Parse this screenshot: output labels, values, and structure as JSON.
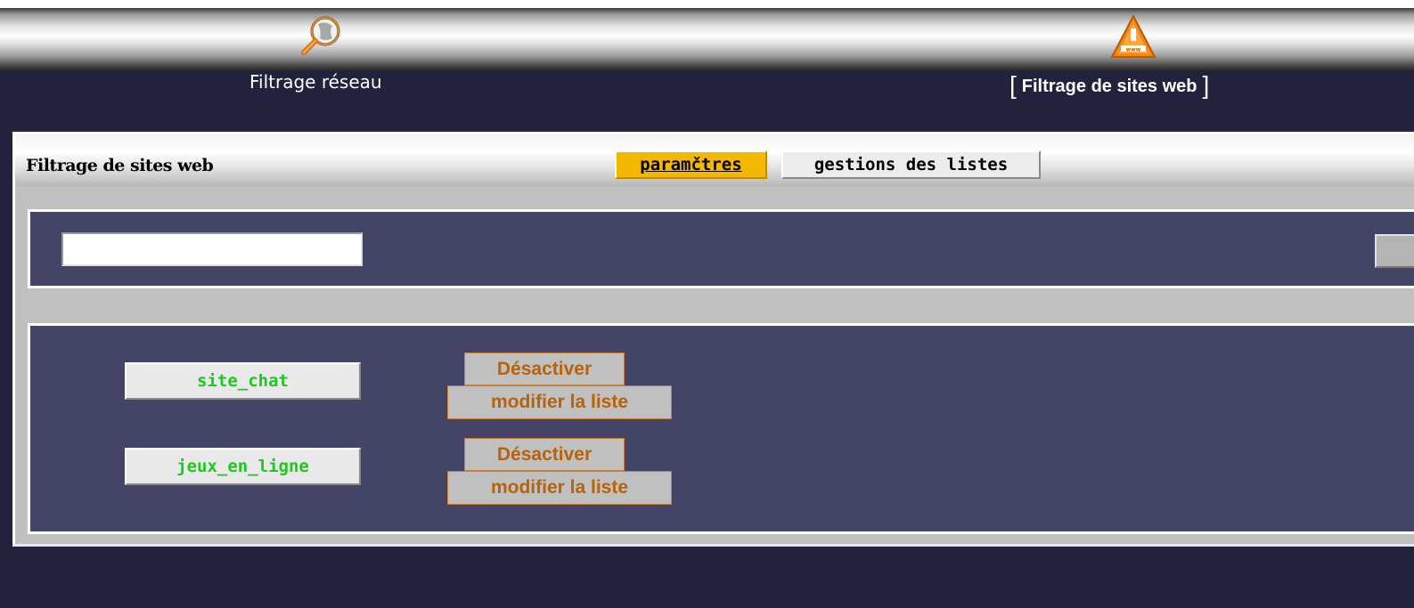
{
  "nav": {
    "items": [
      {
        "label": "Filtrage réseau",
        "icon": "network-filter-icon",
        "active": false
      },
      {
        "label": "Filtrage de sites web",
        "icon": "web-filter-warning-icon",
        "active": true
      }
    ],
    "active_bracket_open": "[",
    "active_bracket_close": "]"
  },
  "panel": {
    "title": "Filtrage de sites web",
    "tabs": [
      {
        "label": "paramčtres",
        "active": true
      },
      {
        "label": "gestions des listes",
        "active": false
      }
    ]
  },
  "search": {
    "value": "",
    "placeholder": ""
  },
  "lists": [
    {
      "name": "site_chat",
      "deactivate_label": "Désactiver",
      "modify_label": "modifier la liste"
    },
    {
      "name": "jeux_en_ligne",
      "deactivate_label": "Désactiver",
      "modify_label": "modifier la liste"
    }
  ],
  "colors": {
    "background": "#22223f",
    "box": "#444466",
    "active_tab": "#f5b800",
    "list_name_text": "#1ec81e",
    "button_text": "#b8620a"
  }
}
